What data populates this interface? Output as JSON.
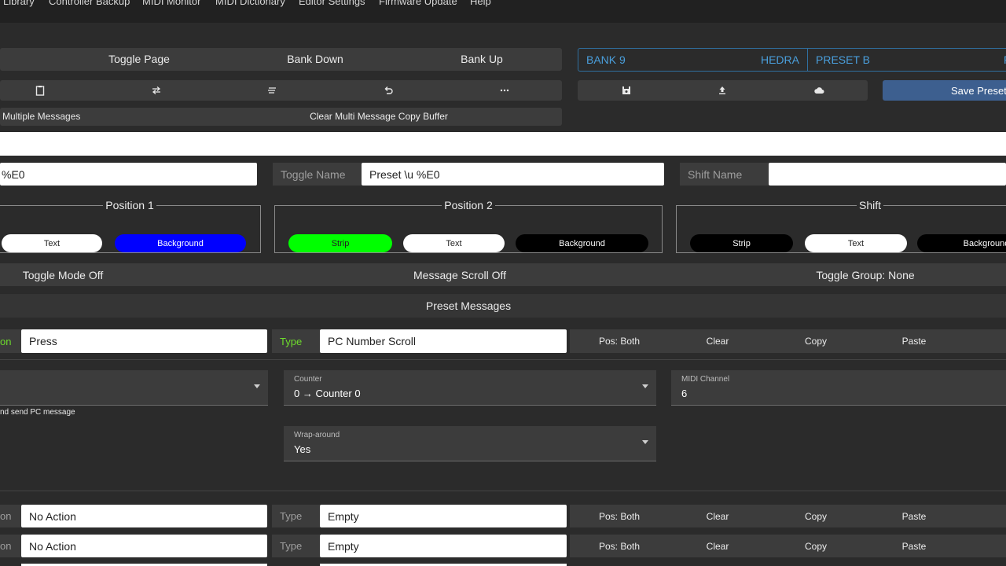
{
  "menu": [
    "Library",
    "Controller Backup",
    "MIDI Monitor",
    "MIDI Dictionary",
    "Editor Settings",
    "Firmware Update",
    "Help"
  ],
  "toolbar": {
    "toggle_page": "Toggle Page",
    "bank_down": "Bank Down",
    "bank_up": "Bank Up"
  },
  "bank": {
    "bank_name": "BANK 9",
    "bank_right": "HEDRA",
    "preset_name": "PRESET B",
    "preset_right": "P"
  },
  "multi": {
    "left": "Multiple Messages",
    "clear": "Clear Multi Message Copy Buffer"
  },
  "save_preset": "Save Preset",
  "names": {
    "name_value": "%E0",
    "toggle_label": "Toggle Name",
    "toggle_value": "Preset \\u %E0",
    "shift_label": "Shift Name",
    "shift_value": ""
  },
  "positions": {
    "p1": {
      "title": "Position 1",
      "text": "Text",
      "background": "Background"
    },
    "p2": {
      "title": "Position 2",
      "strip": "Strip",
      "text": "Text",
      "background": "Background"
    },
    "shift": {
      "title": "Shift",
      "strip": "Strip",
      "text": "Text",
      "background": "Background"
    }
  },
  "modes": {
    "toggle": "Toggle Mode Off",
    "scroll": "Message Scroll Off",
    "group": "Toggle Group: None"
  },
  "preset_messages": "Preset Messages",
  "messages": [
    {
      "action_tag": "on",
      "action": "Press",
      "type_tag": "Type",
      "type": "PC Number Scroll",
      "pos": "Pos: Both",
      "clear": "Clear",
      "copy": "Copy",
      "paste": "Paste"
    },
    {
      "action_tag": "on",
      "action": "No Action",
      "type_tag": "Type",
      "type": "Empty",
      "pos": "Pos: Both",
      "clear": "Clear",
      "copy": "Copy",
      "paste": "Paste"
    },
    {
      "action_tag": "on",
      "action": "No Action",
      "type_tag": "Type",
      "type": "Empty",
      "pos": "Pos: Both",
      "clear": "Clear",
      "copy": "Copy",
      "paste": "Paste"
    }
  ],
  "detail": {
    "counter_caption": "Counter",
    "counter_value": "0 → Counter 0",
    "channel_caption": "MIDI Channel",
    "channel_value": "6",
    "desc": "nd send PC message",
    "wrap_caption": "Wrap-around",
    "wrap_value": "Yes"
  },
  "colors": {
    "bank_accent": "#4a9fdc",
    "save_button": "#3d5f8f",
    "green_tag": "#6edc2c",
    "strip_green": "#00ff00",
    "bg_blue": "#0000ff"
  },
  "icons": [
    "clipboard-icon",
    "swap-icon",
    "list-icon",
    "undo-icon",
    "more-icon",
    "save-icon",
    "upload-icon",
    "cloud-icon"
  ]
}
